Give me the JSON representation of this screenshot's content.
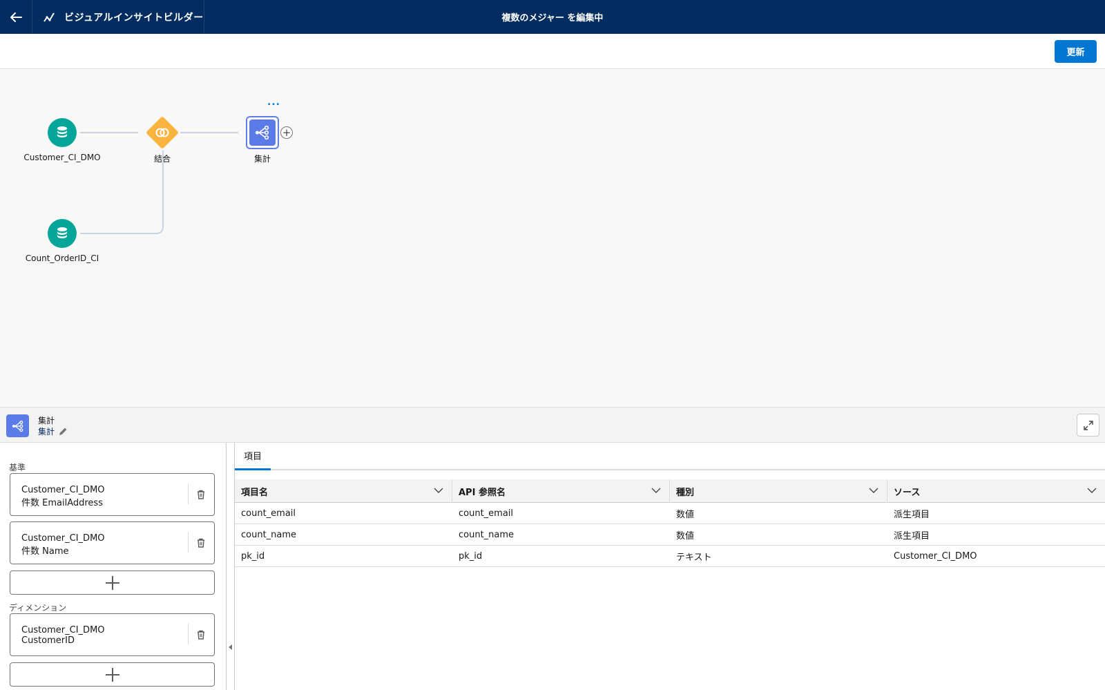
{
  "header": {
    "app_name": "ビジュアルインサイトビルダー",
    "page_title": "複数のメジャー を編集中"
  },
  "toolbar": {
    "update_label": "更新"
  },
  "canvas": {
    "nodes": {
      "source1": "Customer_CI_DMO",
      "join": "結合",
      "aggregate": "集計",
      "source2": "Count_OrderID_CI"
    },
    "more_label": "...",
    "add_label": "+"
  },
  "panel": {
    "type_label": "集計",
    "name_label": "集計"
  },
  "config": {
    "measures_label": "基準",
    "measures": [
      {
        "object": "Customer_CI_DMO",
        "field": "件数 EmailAddress"
      },
      {
        "object": "Customer_CI_DMO",
        "field": "件数 Name"
      }
    ],
    "dimensions_label": "ディメンション",
    "dimensions": [
      {
        "object": "Customer_CI_DMO",
        "field": "CustomerID"
      }
    ]
  },
  "fields_tab": {
    "tab_label": "項目",
    "columns": [
      "項目名",
      "API 参照名",
      "種別",
      "ソース"
    ],
    "rows": [
      [
        "count_email",
        "count_email",
        "数値",
        "派生項目"
      ],
      [
        "count_name",
        "count_name",
        "数値",
        "派生項目"
      ],
      [
        "pk_id",
        "pk_id",
        "テキスト",
        "Customer_CI_DMO"
      ]
    ]
  },
  "colors": {
    "header_bg": "#032d60",
    "brand_blue": "#0176d3",
    "source_teal": "#06a59a",
    "join_orange": "#f9b33f",
    "aggregate_purple": "#5b7be8"
  },
  "icons": [
    "back-arrow-icon",
    "trend-line-icon",
    "database-icon",
    "join-icon",
    "aggregate-icon",
    "edit-pencil-icon",
    "expand-icon",
    "trash-icon",
    "plus-icon",
    "chevron-down-icon"
  ]
}
